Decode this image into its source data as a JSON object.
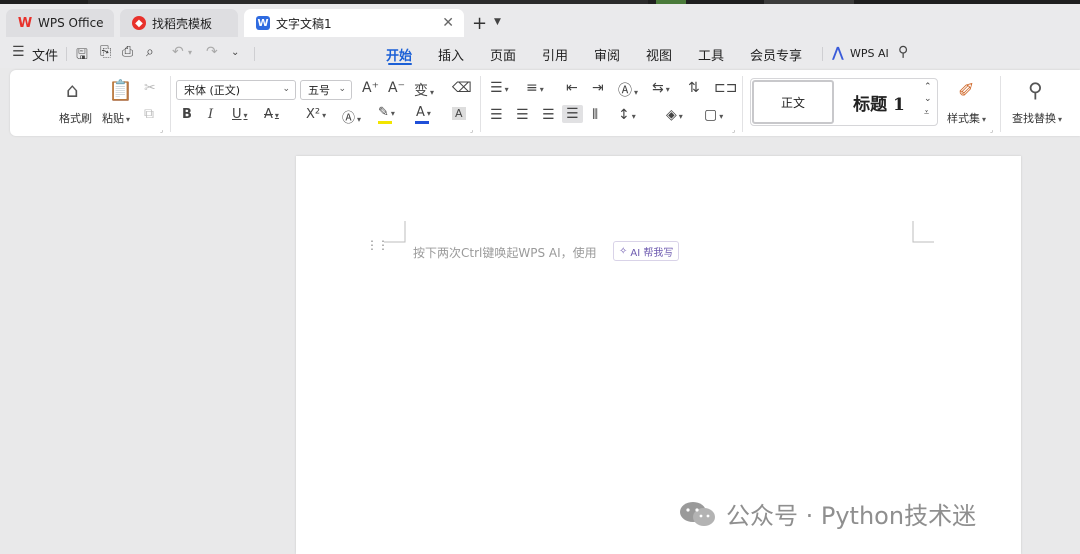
{
  "tabs": [
    {
      "label": "WPS Office",
      "icon": "wps-logo-icon"
    },
    {
      "label": "找稻壳模板",
      "icon": "docer-icon"
    },
    {
      "label": "文字文稿1",
      "icon": "writer-doc-icon",
      "active": true
    }
  ],
  "tab_add": "+",
  "menu": {
    "file": "文件",
    "tabs": [
      "开始",
      "插入",
      "页面",
      "引用",
      "审阅",
      "视图",
      "工具",
      "会员专享"
    ],
    "active": "开始",
    "wps_ai": "WPS AI"
  },
  "ribbon": {
    "format_painter": "格式刷",
    "paste": "粘贴",
    "font_name": "宋体 (正文)",
    "font_size": "五号",
    "style_normal": "正文",
    "style_heading": "标题 1",
    "style_set": "样式集",
    "find_replace": "查找替换"
  },
  "document": {
    "hint": "按下两次Ctrl键唤起WPS AI，使用",
    "ai_chip": "AI 帮我写"
  },
  "watermark": "公众号 · Python技术迷",
  "colors": {
    "accent": "#1a5fd6",
    "wps_red": "#e8312b",
    "font_color_bar": "#1f4fd8",
    "highlight_bar": "#f2e500"
  }
}
